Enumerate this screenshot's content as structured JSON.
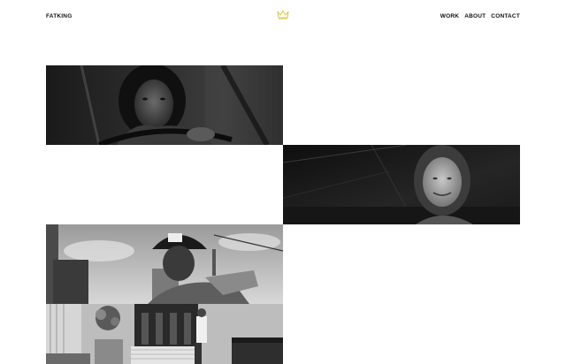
{
  "header": {
    "brand": "FATKING",
    "logo_icon": "crown-icon",
    "nav": [
      "WORK",
      "ABOUT",
      "CONTACT"
    ]
  },
  "colors": {
    "background": "#ffffff",
    "text": "#111111",
    "crown": "#d8c84a"
  },
  "work_tiles": [
    {
      "image": "woman-driving-car-bw"
    },
    {
      "image": "smiling-girl-outdoors-bw"
    },
    {
      "image": "firefighter-fdny-helmet-bw"
    },
    {
      "image": "funeral-home-interior-bw"
    }
  ]
}
